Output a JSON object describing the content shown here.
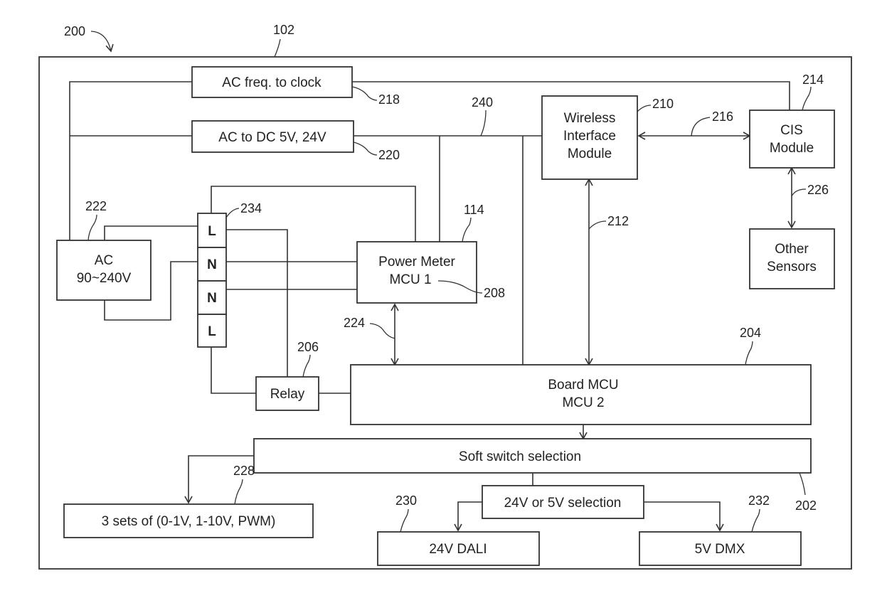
{
  "figure": {
    "ref_figure": "200",
    "ref_enclosure": "102",
    "blocks": {
      "ac_freq": {
        "label": "AC freq. to clock",
        "ref": "218"
      },
      "ac_dc": {
        "label": "AC to DC 5V, 24V",
        "ref": "220"
      },
      "wireless": {
        "lines": [
          "Wireless",
          "Interface",
          "Module"
        ],
        "ref": "210"
      },
      "cis": {
        "lines": [
          "CIS",
          "Module"
        ],
        "ref": "214"
      },
      "other_sensors": {
        "lines": [
          "Other",
          "Sensors"
        ]
      },
      "ac_source": {
        "lines": [
          "AC",
          "90~240V"
        ],
        "ref": "222"
      },
      "terminal": {
        "pins": [
          "L",
          "N",
          "N",
          "L"
        ],
        "ref": "234"
      },
      "power_meter": {
        "lines": [
          "Power Meter",
          "MCU 1"
        ],
        "ref": "114",
        "ref_mcu": "208"
      },
      "relay": {
        "label": "Relay",
        "ref": "206"
      },
      "board_mcu": {
        "lines": [
          "Board MCU",
          "MCU 2"
        ],
        "ref": "204"
      },
      "soft_switch": {
        "label": "Soft switch selection",
        "ref": "202"
      },
      "volt_select": {
        "label": "24V or 5V selection"
      },
      "sets": {
        "label": "3 sets of (0-1V, 1-10V, PWM)",
        "ref": "228"
      },
      "dali": {
        "label": "24V DALI",
        "ref": "230"
      },
      "dmx": {
        "label": "5V DMX",
        "ref": "232"
      }
    },
    "connections": {
      "bus_240": "240",
      "link_216": "216",
      "link_212": "212",
      "link_226": "226",
      "link_224": "224"
    }
  }
}
